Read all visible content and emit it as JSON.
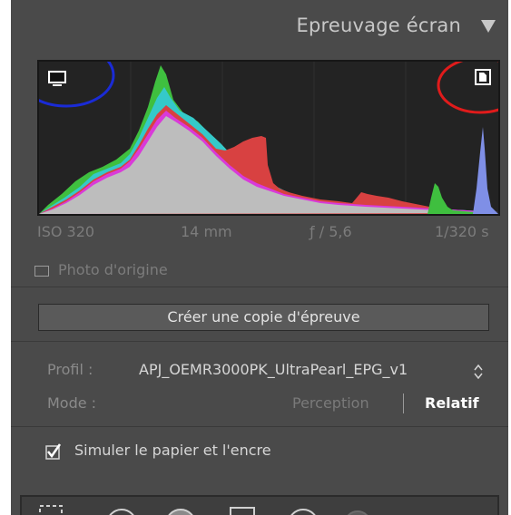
{
  "header": {
    "title": "Epreuvage écran",
    "collapse_icon": "triangle-down-icon"
  },
  "histogram": {
    "left_icon": "monitor-icon",
    "right_icon": "page-icon",
    "colors": {
      "background": "#232323",
      "gray": "#bdbdbd",
      "green": "#3fbf3f",
      "cyan": "#35c9c9",
      "red": "#d84141",
      "magenta": "#d93ad9",
      "blue": "#7f8fe6",
      "annotation_left": "#1a2bd6",
      "annotation_right": "#e01b1b"
    }
  },
  "exif": {
    "iso": "ISO 320",
    "focal": "14 mm",
    "aperture": "ƒ / 5,6",
    "shutter": "1/320 s"
  },
  "original": {
    "label": "Photo d'origine",
    "checked": false
  },
  "copy_button": {
    "label": "Créer une copie d'épreuve"
  },
  "profile": {
    "label": "Profil :",
    "value": "APJ_OEMR3000PK_UltraPearl_EPG_v1",
    "icon": "up-down-stepper-icon"
  },
  "mode": {
    "label": "Mode :",
    "options": [
      "Perception",
      "Relatif"
    ],
    "selected": "Relatif"
  },
  "simulate": {
    "label": "Simuler le papier et l'encre",
    "checked": true
  },
  "toolbar": {
    "icons": [
      "crop-icon",
      "spot-removal-icon",
      "red-eye-icon",
      "graduated-filter-icon",
      "radial-filter-icon",
      "adjustment-brush-icon"
    ]
  }
}
